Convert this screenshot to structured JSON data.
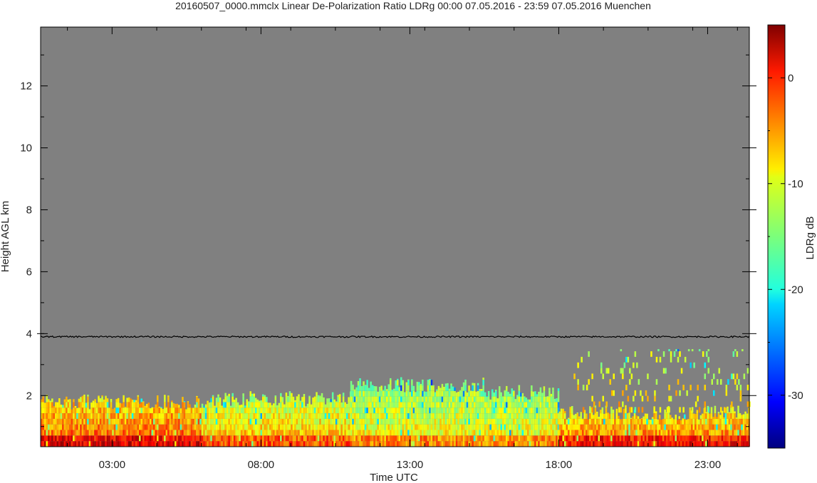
{
  "chart_data": {
    "type": "heatmap",
    "title": "20160507_0000.mmclx Linear De-Polarization Ratio LDRg   00:00 07.05.2016 - 23:59 07.05.2016 Muenchen",
    "xlabel": "Time UTC",
    "ylabel": "Height AGL km",
    "x_unit": "hour UTC",
    "xlim": [
      0.6,
      24.4
    ],
    "ylim": [
      0.35,
      13.9
    ],
    "x_ticks": [
      {
        "value": 3,
        "label": "03:00"
      },
      {
        "value": 8,
        "label": "08:00"
      },
      {
        "value": 13,
        "label": "13:00"
      },
      {
        "value": 18,
        "label": "18:00"
      },
      {
        "value": 23,
        "label": "23:00"
      }
    ],
    "y_ticks": [
      {
        "value": 2,
        "label": "2"
      },
      {
        "value": 4,
        "label": "4"
      },
      {
        "value": 6,
        "label": "6"
      },
      {
        "value": 8,
        "label": "8"
      },
      {
        "value": 10,
        "label": "10"
      },
      {
        "value": 12,
        "label": "12"
      }
    ],
    "background_color": "#808080",
    "reference_line": {
      "height_km": 3.9,
      "color": "#000000"
    },
    "colorbar": {
      "label": "LDRg dB",
      "range": [
        -35,
        5
      ],
      "ticks": [
        {
          "value": 0,
          "label": "0"
        },
        {
          "value": -10,
          "label": "-10"
        },
        {
          "value": -20,
          "label": "-20"
        },
        {
          "value": -30,
          "label": "-30"
        }
      ],
      "colormap": "jet"
    },
    "regions": [
      {
        "t0": 0.6,
        "t1": 6.0,
        "h0": 0.35,
        "h1": 1.8,
        "ldr_db": -3
      },
      {
        "t0": 6.0,
        "t1": 11.0,
        "h0": 0.35,
        "h1": 1.9,
        "ldr_db": -7
      },
      {
        "t0": 11.0,
        "t1": 15.5,
        "h0": 0.35,
        "h1": 2.35,
        "ldr_db": -9
      },
      {
        "t0": 15.5,
        "t1": 18.0,
        "h0": 0.35,
        "h1": 2.1,
        "ldr_db": -9
      },
      {
        "t0": 18.0,
        "t1": 24.4,
        "h0": 0.35,
        "h1": 1.45,
        "ldr_db": -4
      },
      {
        "t0": 18.5,
        "t1": 24.4,
        "h0": 1.45,
        "h1": 3.5,
        "ldr_db": -8,
        "sparse": true
      }
    ]
  }
}
